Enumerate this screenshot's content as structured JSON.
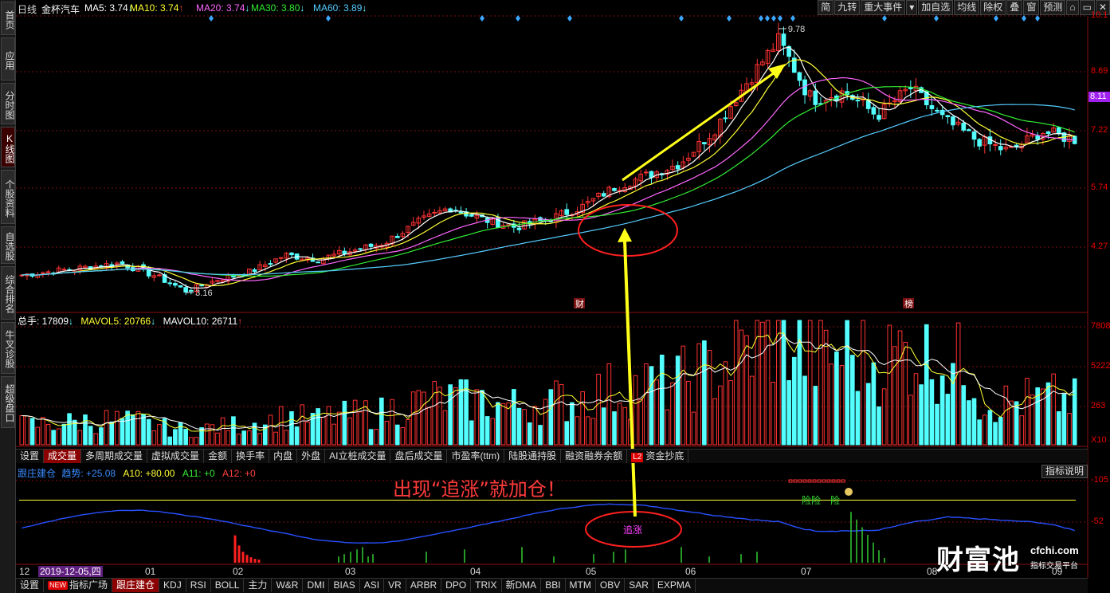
{
  "left_tabs": [
    {
      "label": "首页",
      "active": false
    },
    {
      "label": "应用",
      "active": false,
      "prefix": "⮎"
    },
    {
      "label": "分时图",
      "active": false
    },
    {
      "label": "K线图",
      "active": true
    },
    {
      "label": "个股资料",
      "active": false
    },
    {
      "label": "自选股",
      "active": false
    },
    {
      "label": "综合排名",
      "active": false
    },
    {
      "label": "牛叉诊股",
      "active": false
    },
    {
      "label": "超级盘口",
      "active": false
    }
  ],
  "header": {
    "period": "日线",
    "stock_name": "金杯汽车",
    "ma5": "MA5: 3.74",
    "ma10": "MA10: 3.74",
    "ma20": "MA20: 3.74",
    "ma30": "MA30: 3.80",
    "ma60": "MA60: 3.89",
    "up_arrow": "↑",
    "down_arrow": "↓"
  },
  "toolbar": [
    "简",
    "九转",
    "重大事件",
    "▾",
    "加自选",
    "均线",
    "除权",
    "叠",
    "窗",
    "预测",
    "⌂",
    "▭",
    "✕"
  ],
  "price_axis": {
    "ticks": [
      "10.1",
      "8.69",
      "7.22",
      "5.74",
      "4.27"
    ],
    "current": "8.11"
  },
  "price_marks": {
    "high": "9.78",
    "low": "3.16",
    "cai_badge": "财",
    "bang_badge": "榜"
  },
  "volume": {
    "total": "总手: 17809",
    "mavol5": "MAVOL5: 20766",
    "mavol10": "MAVOL10: 26711",
    "axis": [
      "7808",
      "5222",
      "263",
      "X10"
    ]
  },
  "volume_tabs": [
    "设置",
    "成交量",
    "多周期成交量",
    "虚拟成交量",
    "金额",
    "换手率",
    "内盘",
    "外盘",
    "AI立桩成交量",
    "盘后成交量",
    "市盈率(ttm)",
    "陆股通持股",
    "融资融券余额",
    "资金抄底"
  ],
  "volume_tab_badge": "L2",
  "indicator": {
    "name": "跟庄建仓",
    "trend": "趋势: +25.08",
    "a10": "A10: +80.00",
    "a11": "A11: +0",
    "a12": "A12: +0",
    "help": "指标说明",
    "axis": [
      "105",
      "52"
    ],
    "risk1": "险险",
    "risk2": "险",
    "zz_label": "追涨"
  },
  "annotation": "出现“追涨”就加仓！",
  "date_axis": {
    "left": "12",
    "current": "2019-12-05,四",
    "months": [
      "01",
      "02",
      "03",
      "04",
      "05",
      "06",
      "07",
      "08",
      "09"
    ]
  },
  "indicator_tabs": [
    "设置",
    "指标广场",
    "跟庄建仓",
    "KDJ",
    "RSI",
    "BOLL",
    "主力",
    "W&R",
    "DMI",
    "BIAS",
    "ASI",
    "VR",
    "ARBR",
    "DPO",
    "TRIX",
    "新DMA",
    "BBI",
    "MTM",
    "OBV",
    "SAR",
    "EXPMA"
  ],
  "new_badge": "NEW",
  "watermark": {
    "brand": "财富池",
    "domain": "cfchi.com",
    "sub": "指标交易平台"
  },
  "chart_data": {
    "type": "line",
    "months": [
      "12",
      "01",
      "02",
      "03",
      "04",
      "05",
      "06",
      "07",
      "08",
      "09"
    ],
    "price_range": [
      2.8,
      10.1
    ],
    "close_keypoints": [
      3.6,
      3.7,
      3.8,
      3.9,
      3.6,
      3.2,
      3.5,
      3.7,
      4.1,
      4.0,
      4.2,
      4.4,
      4.9,
      5.3,
      5.0,
      4.8,
      5.0,
      5.3,
      5.8,
      6.1,
      6.4,
      7.2,
      8.4,
      9.5,
      8.0,
      8.2,
      7.6,
      8.3,
      7.5,
      7.0,
      6.7,
      7.2,
      7.0
    ],
    "volume_range": [
      0,
      7808
    ],
    "indicator_range": [
      0,
      105
    ],
    "a10_level": 80
  }
}
